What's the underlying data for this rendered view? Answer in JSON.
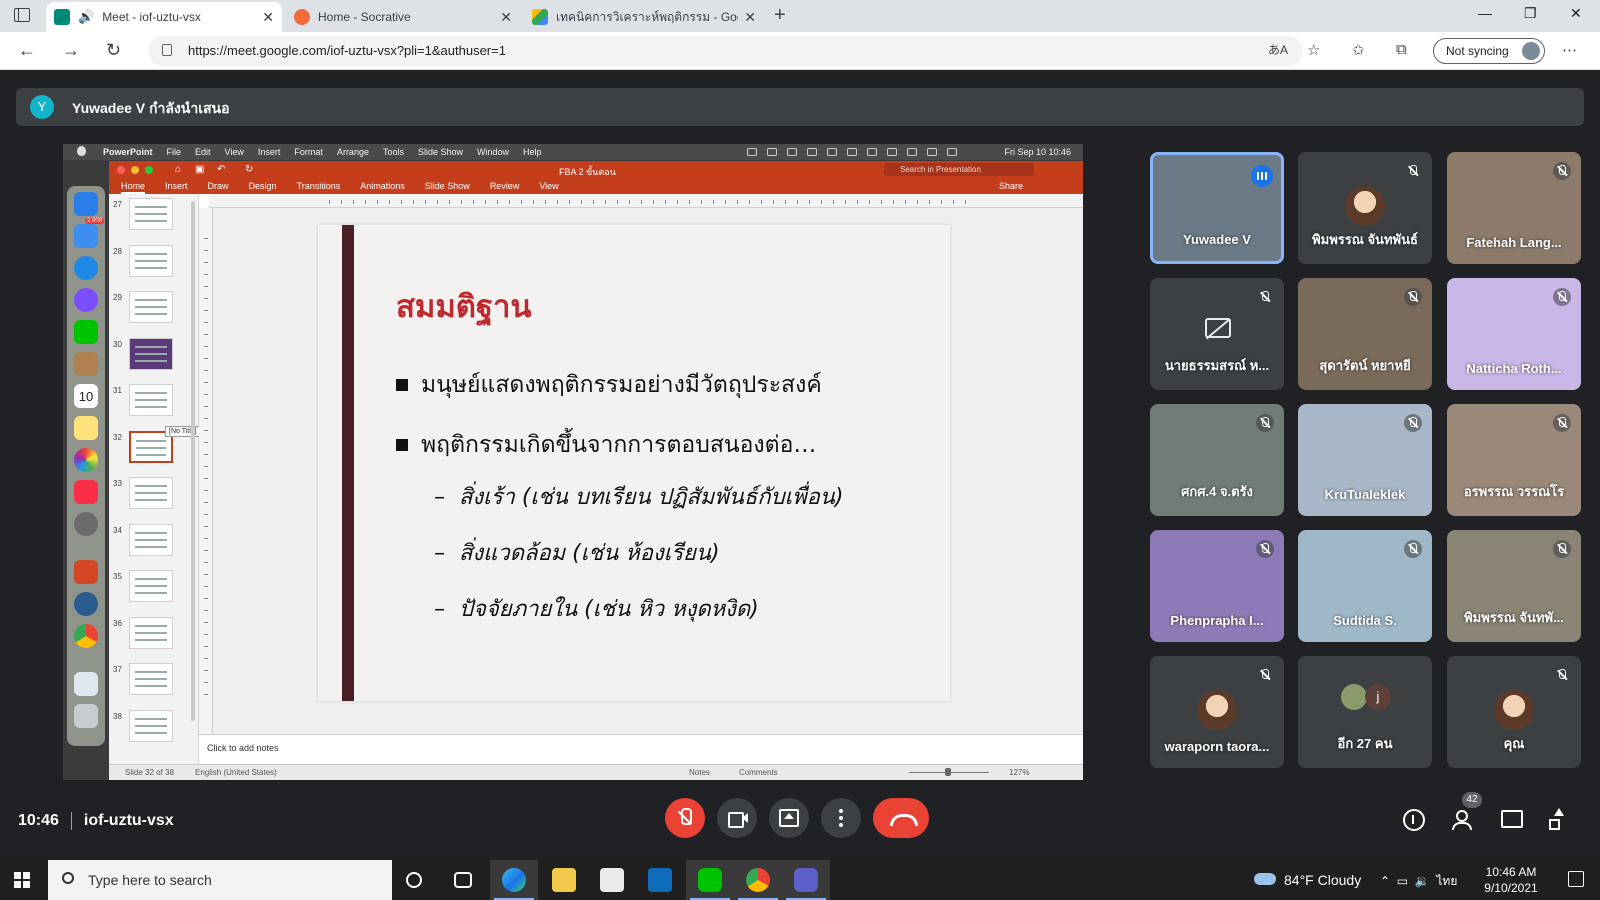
{
  "browser": {
    "tabs": [
      {
        "title": "Meet - iof-uztu-vsx",
        "active": true
      },
      {
        "title": "Home - Socrative",
        "active": false
      },
      {
        "title": "เทคนิคการวิเคราะห์พฤติกรรม - Goog",
        "active": false
      }
    ],
    "url": "https://meet.google.com/iof-uztu-vsx?pli=1&authuser=1",
    "sync_label": "Not syncing"
  },
  "presenter_bar": {
    "avatar_letter": "Y",
    "text": "Yuwadee V กำลังนำเสนอ"
  },
  "mac": {
    "menu": [
      "PowerPoint",
      "File",
      "Edit",
      "View",
      "Insert",
      "Format",
      "Arrange",
      "Tools",
      "Slide Show",
      "Window",
      "Help"
    ],
    "clock": "Fri Sep 10 10:46",
    "dock_badge": "2,909",
    "dock_calendar_day": "10"
  },
  "powerpoint": {
    "doc_title": "FBA 2 ขั้นตอน",
    "search_placeholder": "Search in Presentation",
    "ribbon": [
      "Home",
      "Insert",
      "Draw",
      "Design",
      "Transitions",
      "Animations",
      "Slide Show",
      "Review",
      "View"
    ],
    "share": "Share",
    "thumb_numbers": [
      "27",
      "28",
      "29",
      "30",
      "31",
      "32",
      "33",
      "34",
      "35",
      "36",
      "37",
      "38"
    ],
    "selected_thumb": "32",
    "tooltip": "[No Title]",
    "notes_placeholder": "Click to add notes",
    "status": {
      "slide": "Slide 32 of 38",
      "lang": "English (United States)",
      "notes": "Notes",
      "comments": "Comments",
      "zoom": "127%"
    },
    "slide": {
      "title": "สมมติฐาน",
      "bullets": [
        "มนุษย์แสดงพฤติกรรมอย่างมีวัตถุประสงค์",
        "พฤติกรรมเกิดขึ้นจากการตอบสนองต่อ…"
      ],
      "sub_bullets": [
        "สิ่งเร้า (เช่น บทเรียน ปฏิสัมพันธ์กับเพื่อน)",
        "สิ่งแวดล้อม (เช่น ห้องเรียน)",
        "ปัจจัยภายใน (เช่น หิว หงุดหงิด)"
      ]
    }
  },
  "participants": [
    {
      "name": "Yuwadee V",
      "muted": false,
      "speaking": true,
      "bg": "#6a7a86"
    },
    {
      "name": "พิมพรรณ จันทพันธ์",
      "muted": true,
      "speaking": false,
      "bg": "#3c4043",
      "avatar": true
    },
    {
      "name": "Fatehah Lang...",
      "muted": true,
      "speaking": false,
      "bg": "#8c7b6b"
    },
    {
      "name": "นายธรรมสรณ์ ห...",
      "muted": true,
      "speaking": false,
      "bg": "#3c4043",
      "camoff": true
    },
    {
      "name": "สุดารัตน์ หยาหยี",
      "muted": true,
      "speaking": false,
      "bg": "#7a6a5a"
    },
    {
      "name": "Natticha Roth...",
      "muted": true,
      "speaking": false,
      "bg": "#c9b7e8"
    },
    {
      "name": "ศกศ.4 จ.ตรัง",
      "muted": true,
      "speaking": false,
      "bg": "#6f7d76"
    },
    {
      "name": "KruTualeklek",
      "muted": true,
      "speaking": false,
      "bg": "#a8b8c8"
    },
    {
      "name": "อรพรรณ วรรณโร",
      "muted": true,
      "speaking": false,
      "bg": "#9a8878"
    },
    {
      "name": "Phenprapha I...",
      "muted": true,
      "speaking": false,
      "bg": "#8f7ab8"
    },
    {
      "name": "Sudtida S.",
      "muted": true,
      "speaking": false,
      "bg": "#9fb8c8"
    },
    {
      "name": "พิมพรรณ จันทพั...",
      "muted": true,
      "speaking": false,
      "bg": "#8a8474"
    },
    {
      "name": "waraporn taora...",
      "muted": true,
      "speaking": false,
      "bg": "#3c4043",
      "avatar": true
    },
    {
      "name": "อีก 27 คน",
      "muted": false,
      "speaking": false,
      "bg": "#3c4043",
      "more": true,
      "more_letter": "j"
    },
    {
      "name": "คุณ",
      "muted": true,
      "speaking": false,
      "bg": "#3c4043",
      "avatar": true
    }
  ],
  "meet_bar": {
    "time": "10:46",
    "code": "iof-uztu-vsx",
    "people_count": "42"
  },
  "taskbar": {
    "search_placeholder": "Type here to search",
    "weather": "84°F  Cloudy",
    "lang": "ไทย",
    "time": "10:46 AM",
    "date": "9/10/2021"
  }
}
